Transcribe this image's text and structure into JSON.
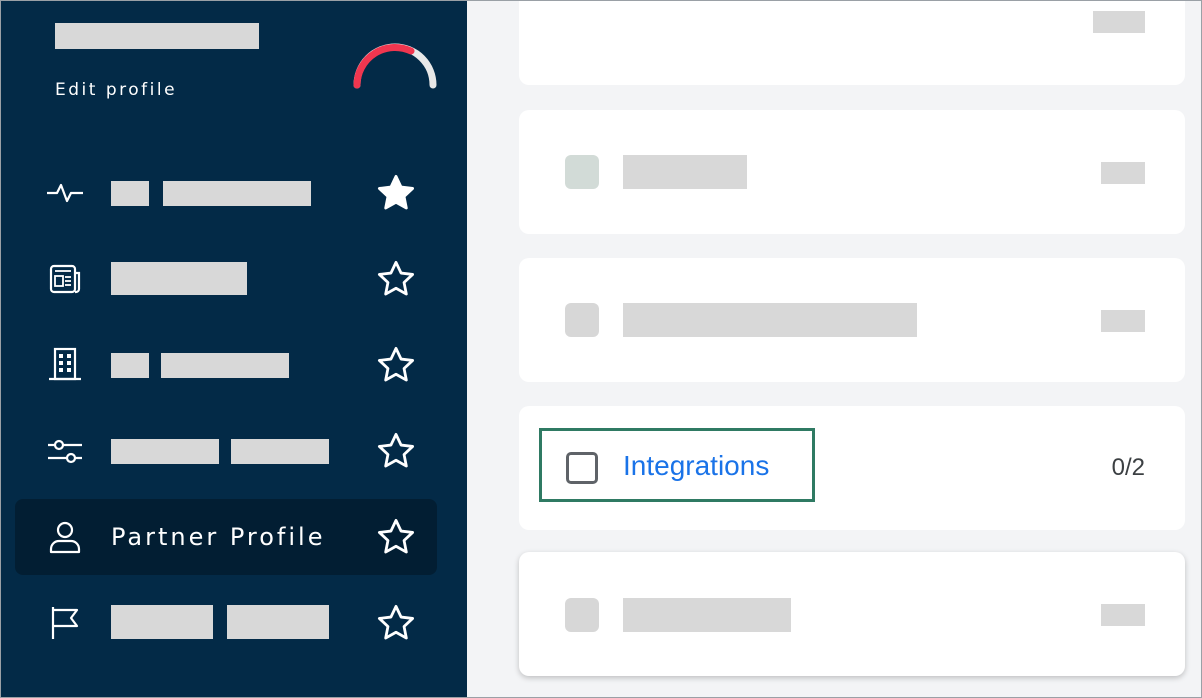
{
  "sidebar": {
    "edit_profile": "Edit profile",
    "gauge_colors": {
      "progress": "#f0364f",
      "track": "#e8e8e8"
    },
    "items": [
      {
        "icon": "activity-icon",
        "favorite": true
      },
      {
        "icon": "news-icon",
        "favorite": false
      },
      {
        "icon": "building-icon",
        "favorite": false
      },
      {
        "icon": "sliders-icon",
        "favorite": false
      },
      {
        "icon": "person-icon",
        "label": "Partner Profile",
        "favorite": false,
        "active": true
      },
      {
        "icon": "flag-icon",
        "favorite": false
      }
    ]
  },
  "main": {
    "integrations": {
      "label": "Integrations",
      "count": "0/2",
      "checked": false
    }
  },
  "colors": {
    "sidebar_bg": "#032a47",
    "active_bg": "#021e33",
    "link": "#1a73e8",
    "highlight": "#2f7a63"
  }
}
